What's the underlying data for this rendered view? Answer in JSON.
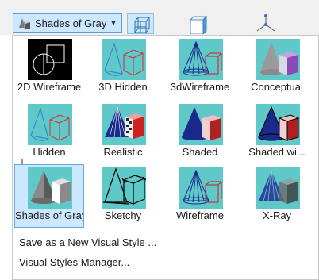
{
  "toolbar": {
    "current_style": "Shades of Gray",
    "dropdown_arrow": "▼"
  },
  "styles": [
    {
      "label": "2D Wireframe",
      "thumb": "2d-wireframe"
    },
    {
      "label": "3D Hidden",
      "thumb": "3d-hidden"
    },
    {
      "label": "3dWireframe",
      "thumb": "3d-wireframe"
    },
    {
      "label": "Conceptual",
      "thumb": "conceptual"
    },
    {
      "label": "Hidden",
      "thumb": "hidden"
    },
    {
      "label": "Realistic",
      "thumb": "realistic"
    },
    {
      "label": "Shaded",
      "thumb": "shaded"
    },
    {
      "label": "Shaded wi...",
      "thumb": "shaded-with-edges"
    },
    {
      "label": "Shades of Gray",
      "thumb": "shades-of-gray",
      "selected": true
    },
    {
      "label": "Sketchy",
      "thumb": "sketchy"
    },
    {
      "label": "Wireframe",
      "thumb": "wireframe"
    },
    {
      "label": "X-Ray",
      "thumb": "x-ray"
    }
  ],
  "menu": {
    "save_as_new": "Save as a New Visual Style ...",
    "manager": "Visual Styles Manager..."
  },
  "colors": {
    "thumb_bg": "#5fc8c8",
    "selected_bg": "#cce8ff",
    "cone_blue": "#1a2a8c",
    "cube_red": "#d02020",
    "conceptual_cube": "#8a4ab8"
  }
}
